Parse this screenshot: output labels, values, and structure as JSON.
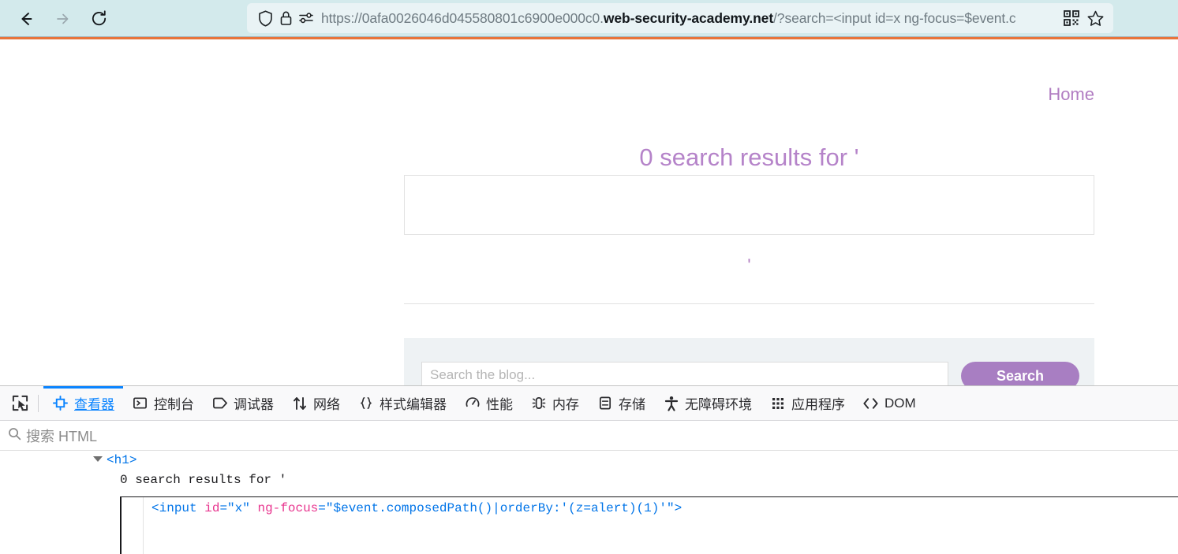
{
  "browser": {
    "back_label": "back-arrow",
    "forward_label": "forward-arrow",
    "reload_label": "reload",
    "url_prefix": "https://0afa0026046d045580801c6900e000c0.",
    "url_host": "web-security-academy.net",
    "url_path": "/?search=<input id=x ng-focus=$event.c",
    "shield_icon": "tracking-protection-shield",
    "lock_icon": "padlock",
    "permissions_icon": "site-permissions",
    "qr_icon": "qr-code",
    "bookmark_icon": "star-bookmark"
  },
  "page": {
    "accent_color": "#e8743b",
    "home_link": "Home",
    "heading": "0 search results for '",
    "injected_input_value": "",
    "stray_text": "'",
    "search_placeholder": "Search the blog...",
    "search_button": "Search",
    "link_color": "#b17dc2",
    "button_color": "#a87ec2"
  },
  "devtools": {
    "picker_icon": "element-picker-icon",
    "tabs": [
      {
        "label": "查看器",
        "icon": "inspector-icon",
        "active": true
      },
      {
        "label": "控制台",
        "icon": "console-icon",
        "active": false
      },
      {
        "label": "调试器",
        "icon": "debugger-icon",
        "active": false
      },
      {
        "label": "网络",
        "icon": "network-icon",
        "active": false
      },
      {
        "label": "样式编辑器",
        "icon": "style-editor-icon",
        "active": false
      },
      {
        "label": "性能",
        "icon": "performance-icon",
        "active": false
      },
      {
        "label": "内存",
        "icon": "memory-icon",
        "active": false
      },
      {
        "label": "存储",
        "icon": "storage-icon",
        "active": false
      },
      {
        "label": "无障碍环境",
        "icon": "accessibility-icon",
        "active": false
      },
      {
        "label": "应用程序",
        "icon": "application-icon",
        "active": false
      },
      {
        "label": "DOM",
        "icon": "dom-icon",
        "active": false
      }
    ],
    "active_tab_color": "#0a84ff",
    "html_search_placeholder": "搜索 HTML",
    "dom": {
      "h1_open_lt": "<",
      "h1_tag": "h1",
      "h1_open_gt": ">",
      "text_node": "0 search results for '",
      "input_lt": "<",
      "input_tag": "input",
      "attr1_name": "id",
      "attr1_eq": "=",
      "attr1_value": "\"x\"",
      "attr2_name": "ng-focus",
      "attr2_eq": "=",
      "attr2_value": "\"$event.composedPath()|orderBy:'(z=alert)(1)'\"",
      "input_gt": ">"
    }
  }
}
